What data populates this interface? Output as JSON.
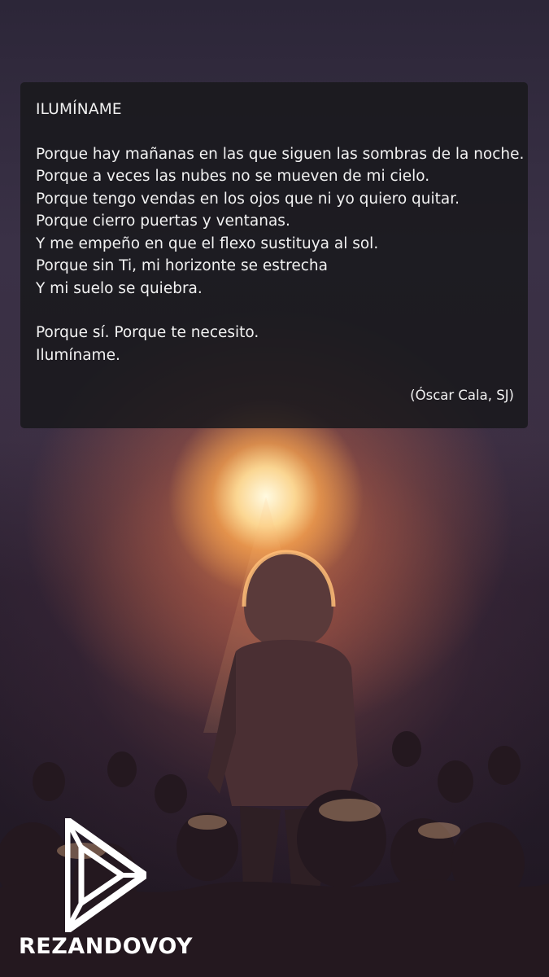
{
  "poem": {
    "title": "ILUMÍNAME",
    "stanza1": [
      "Porque hay mañanas en las que siguen las sombras de la noche.",
      "Porque a veces las nubes no se mueven de mi cielo.",
      "Porque tengo vendas en los ojos que ni yo quiero quitar.",
      "Porque cierro puertas y ventanas.",
      "Y me empeño en que el flexo sustituya al sol.",
      "Porque sin Ti, mi horizonte se estrecha",
      "Y mi suelo se quiebra."
    ],
    "stanza2": [
      "Porque sí. Porque te necesito.",
      "Ilumíname."
    ],
    "author": "(Óscar Cala, SJ)"
  },
  "brand": {
    "name": "REZANDOVOY",
    "logo_icon": "play-triangle-logo-icon"
  },
  "background": {
    "scene": "sunset-concert-photo",
    "glow_color": "#ffd89a",
    "sky_color": "#3a3146"
  }
}
